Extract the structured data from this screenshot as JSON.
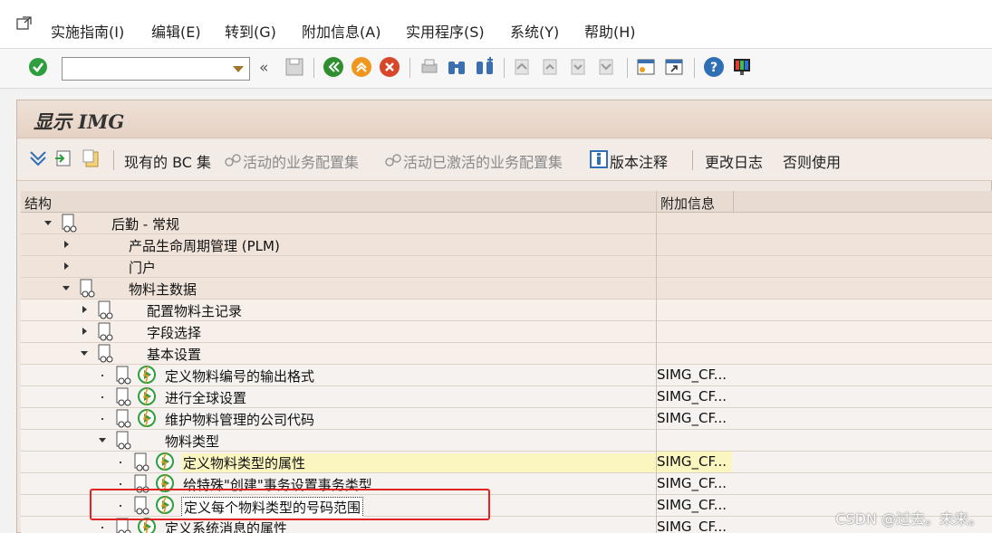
{
  "menu": {
    "items": [
      "实施指南(I)",
      "编辑(E)",
      "转到(G)",
      "附加信息(A)",
      "实用程序(S)",
      "系统(Y)",
      "帮助(H)"
    ]
  },
  "toolbar": {
    "command_value": "",
    "colors": {
      "ok_green": "#2e9e3e",
      "nav_green": "#2f8f2f",
      "nav_orange": "#f0961e",
      "nav_red": "#d9472b",
      "help_blue": "#2f6fb5"
    }
  },
  "screen": {
    "title": "显示 IMG"
  },
  "app_toolbar": {
    "bc_sets": "现有的 BC 集",
    "active_config": "活动的业务配置集",
    "activated_config": "活动已激活的业务配置集",
    "release_notes": "版本注释",
    "change_log": "更改日志",
    "else_use": "否则使用"
  },
  "tree": {
    "headers": {
      "structure": "结构",
      "info": "附加信息"
    },
    "rows": [
      {
        "label": "后勤 - 常规",
        "info": ""
      },
      {
        "label": "产品生命周期管理 (PLM)",
        "info": ""
      },
      {
        "label": "门户",
        "info": ""
      },
      {
        "label": "物料主数据",
        "info": ""
      },
      {
        "label": "配置物料主记录",
        "info": ""
      },
      {
        "label": "字段选择",
        "info": ""
      },
      {
        "label": "基本设置",
        "info": ""
      },
      {
        "label": "定义物料编号的输出格式",
        "info": "SIMG_CF..."
      },
      {
        "label": "进行全球设置",
        "info": "SIMG_CF..."
      },
      {
        "label": "维护物料管理的公司代码",
        "info": "SIMG_CF..."
      },
      {
        "label": "物料类型",
        "info": ""
      },
      {
        "label": "定义物料类型的属性",
        "info": "SIMG_CF..."
      },
      {
        "label": "给特殊\"创建\"事务设置事务类型",
        "info": "SIMG_CF..."
      },
      {
        "label": "定义每个物料类型的号码范围",
        "info": "SIMG_CF..."
      },
      {
        "label": "定义系统消息的属性",
        "info": "SIMG_CF..."
      }
    ]
  },
  "watermark": "CSDN @过去。未来。"
}
